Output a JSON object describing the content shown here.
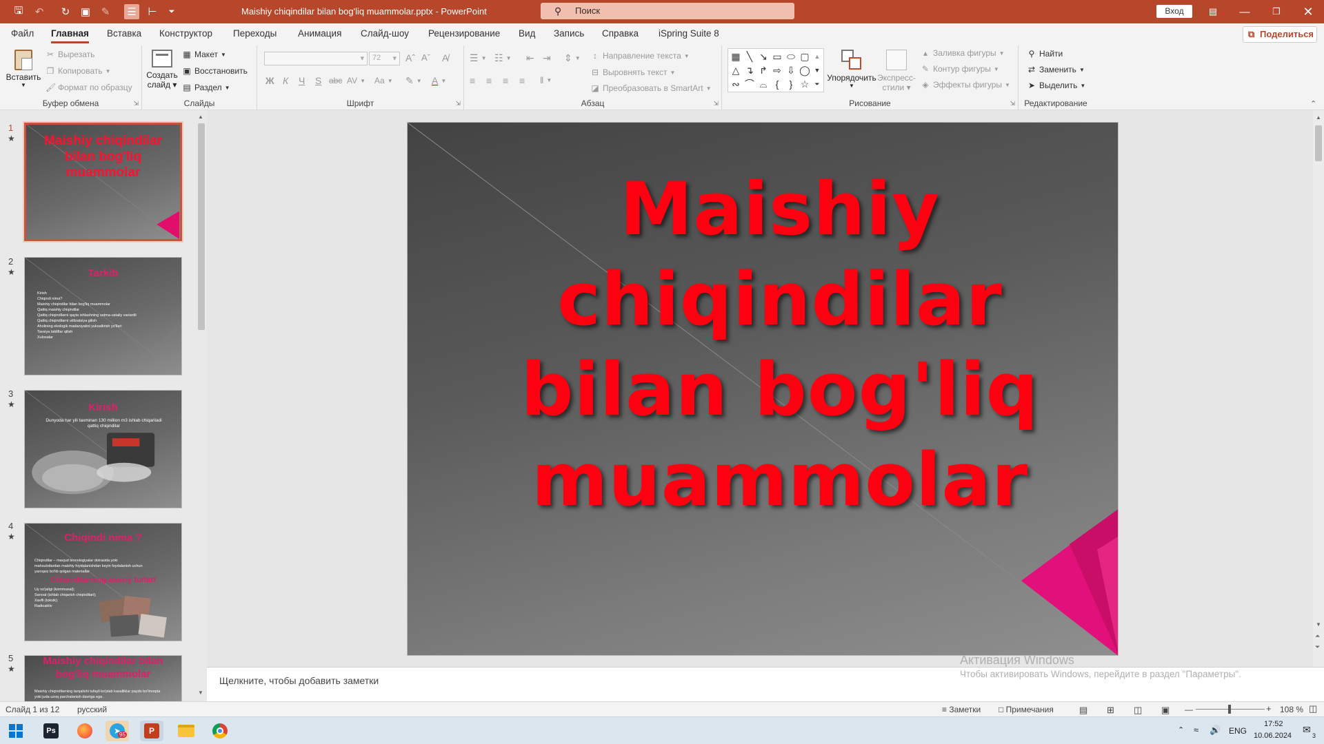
{
  "window": {
    "title": "Maishiy chiqindilar bilan bog'liq muammolar.pptx  -  PowerPoint",
    "search_placeholder": "Поиск",
    "signin": "Вход"
  },
  "tabs": [
    "Файл",
    "Главная",
    "Вставка",
    "Конструктор",
    "Переходы",
    "Анимация",
    "Слайд-шоу",
    "Рецензирование",
    "Вид",
    "Запись",
    "Справка",
    "iSpring Suite 8"
  ],
  "active_tab": "Главная",
  "share_label": "Поделиться",
  "ribbon": {
    "clipboard": {
      "label": "Буфер обмена",
      "paste": "Вставить",
      "cut": "Вырезать",
      "copy": "Копировать",
      "format_painter": "Формат по образцу"
    },
    "slides": {
      "label": "Слайды",
      "new_slide_1": "Создать",
      "new_slide_2": "слайд",
      "layout": "Макет",
      "reset": "Восстановить",
      "section": "Раздел"
    },
    "font": {
      "label": "Шрифт",
      "font_name": "",
      "font_size": "72",
      "bold": "Ж",
      "italic": "К",
      "underline": "Ч",
      "shadow": "S",
      "strike": "abc",
      "spacing": "AV",
      "case": "Aa"
    },
    "paragraph": {
      "label": "Абзац",
      "text_direction": "Направление текста",
      "align_text": "Выровнять текст",
      "smartart": "Преобразовать в SmartArt"
    },
    "drawing": {
      "label": "Рисование",
      "arrange": "Упорядочить",
      "quick_styles_1": "Экспресс-",
      "quick_styles_2": "стили",
      "fill": "Заливка фигуры",
      "outline": "Контур фигуры",
      "effects": "Эффекты фигуры"
    },
    "editing": {
      "label": "Редактирование",
      "find": "Найти",
      "replace": "Заменить",
      "select": "Выделить"
    }
  },
  "thumbnails": [
    {
      "num": "1",
      "title": "Maishiy chiqindilar bilan bog'liq muammolar",
      "lines": []
    },
    {
      "num": "2",
      "title": "Tarkib",
      "lines": [
        "Kirish",
        "Chiqindi nima?",
        "Maishiy chiqindilar bilan bog'liq muammolar",
        "Qattiq maishiy chiqindilar",
        "Qattiq chiqindilarni qayta ishlashning ustma-ustaliy variantli",
        "Qattiq chiqindilarni utilizatsiya gilish",
        "Aholining ekologik madaniyatini yuksaltirish yo'llari",
        "Tavsiya takliflar qilish",
        "Xulosalar"
      ]
    },
    {
      "num": "3",
      "title": "Kirish",
      "lines": [
        "Dunyoda har yili taxminan 130 million m3 ishlab chiqariladi",
        "qattiq chiqindilar"
      ]
    },
    {
      "num": "4",
      "title": "Chiqindi nima ?",
      "subtitle": "Chiqindilarning asosiy turlari",
      "lines": [
        "Chiqindilar – mavjud texnologiyalar doirasida yoki",
        "mahsulotlardan maishiy foydalanishdan keyin foydalanish uchun",
        "yaroqsiz bo'lib qolgan materiallar",
        "Uy xo'jaligi (kommunal);",
        "Sanoat (ishlab chiqarish chiqindilari);",
        "Xavfli (toksik);",
        "Radioaktiv"
      ]
    },
    {
      "num": "5",
      "title": "Maishiy chiqindilar bilan bog'liq muammolar",
      "lines": [
        "Maishiy chiqindilarning tarqalishi tufayli ko'plab kasalliklar paydo bo'lmoqda",
        "yoki juda uzoq parchalanish davriga ega ."
      ]
    }
  ],
  "slide": {
    "title_lines": [
      "Maishiy chiqindilar",
      "bilan bog'liq",
      "muammolar"
    ]
  },
  "notes_placeholder": "Щелкните, чтобы добавить заметки",
  "activation": {
    "line1": "Активация Windows",
    "line2": "Чтобы активировать Windows, перейдите в раздел \"Параметры\"."
  },
  "status": {
    "slide_info": "Слайд 1 из 12",
    "language": "русский",
    "notes": "Заметки",
    "comments": "Примечания",
    "zoom": "108 %"
  },
  "taskbar": {
    "lang": "ENG",
    "time": "17:52",
    "date": "10.06.2024",
    "telegram_badge": "95",
    "notif_count": "3"
  },
  "colors": {
    "accent": "#b7472a",
    "slide_title": "#ff0010",
    "thumb_title": "#e01f6a"
  }
}
